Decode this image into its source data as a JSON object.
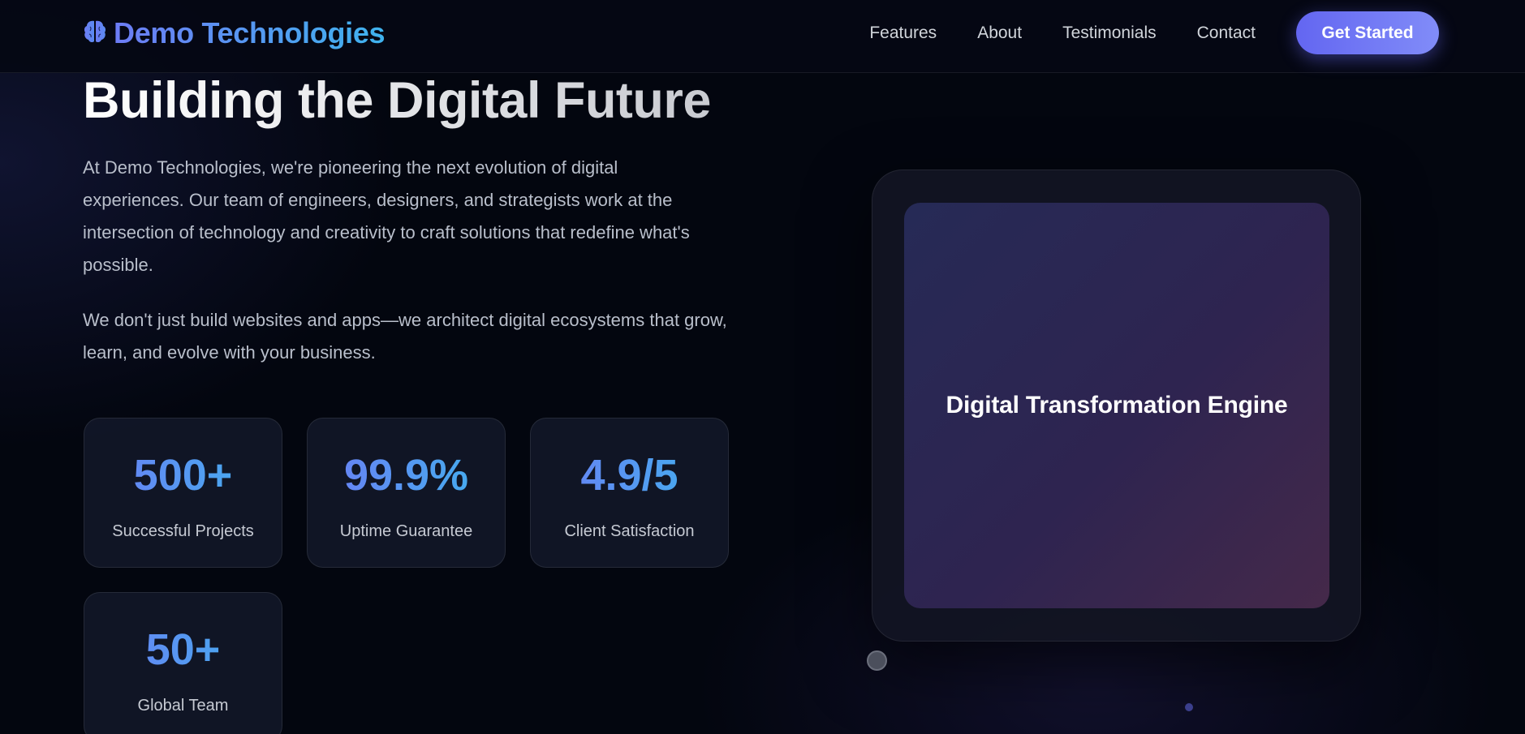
{
  "header": {
    "brand": "Demo Technologies",
    "nav": [
      "Features",
      "About",
      "Testimonials",
      "Contact"
    ],
    "cta_label": "Get Started"
  },
  "hero": {
    "title": "Building the Digital Future",
    "paragraphs": [
      "At Demo Technologies, we're pioneering the next evolution of digital experiences. Our team of engineers, designers, and strategists work at the intersection of technology and creativity to craft solutions that redefine what's possible.",
      "We don't just build websites and apps—we architect digital ecosystems that grow, learn, and evolve with your business."
    ]
  },
  "stats": [
    {
      "value": "500+",
      "label": "Successful Projects"
    },
    {
      "value": "99.9%",
      "label": "Uptime Guarantee"
    },
    {
      "value": "4.9/5",
      "label": "Client Satisfaction"
    },
    {
      "value": "50+",
      "label": "Global Team"
    }
  ],
  "visual": {
    "title": "Digital Transformation Engine"
  },
  "colors": {
    "accent": "#6366f1",
    "gradient_start": "#6d7cf5",
    "gradient_end": "#3fb3ee",
    "background": "#03060f"
  },
  "icons": {
    "logo": "brain-icon"
  }
}
